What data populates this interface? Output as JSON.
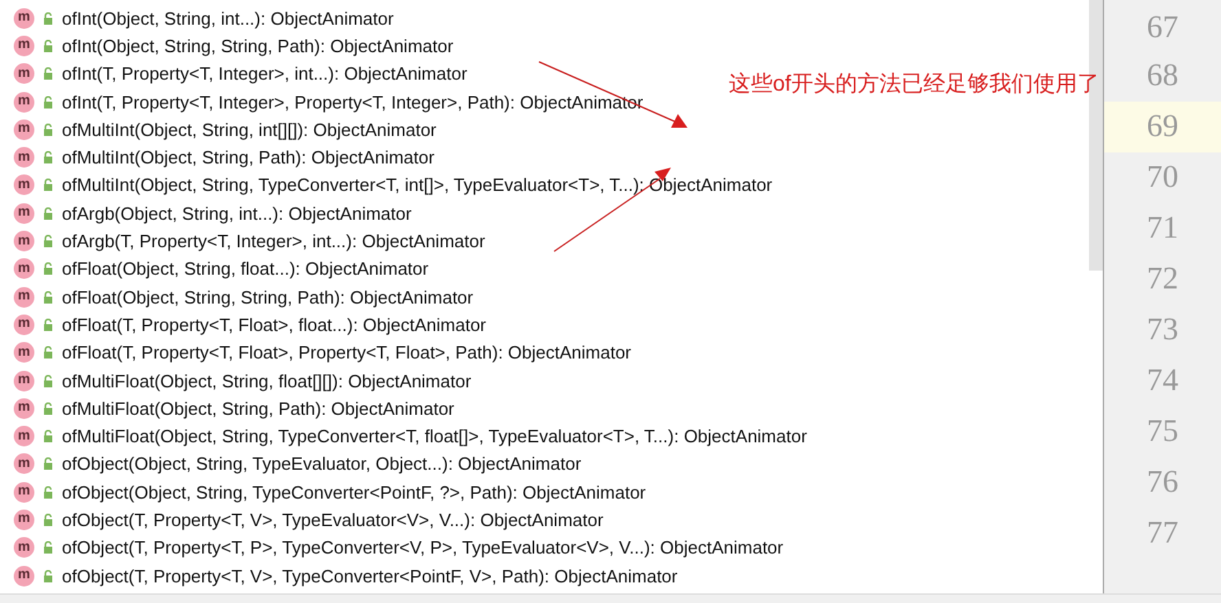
{
  "methods": [
    {
      "icon_letter": "m",
      "signature": "ofInt(Object, String, int...): ObjectAnimator"
    },
    {
      "icon_letter": "m",
      "signature": "ofInt(Object, String, String, Path): ObjectAnimator"
    },
    {
      "icon_letter": "m",
      "signature": "ofInt(T, Property<T, Integer>, int...): ObjectAnimator"
    },
    {
      "icon_letter": "m",
      "signature": "ofInt(T, Property<T, Integer>, Property<T, Integer>, Path): ObjectAnimator"
    },
    {
      "icon_letter": "m",
      "signature": "ofMultiInt(Object, String, int[][]): ObjectAnimator"
    },
    {
      "icon_letter": "m",
      "signature": "ofMultiInt(Object, String, Path): ObjectAnimator"
    },
    {
      "icon_letter": "m",
      "signature": "ofMultiInt(Object, String, TypeConverter<T, int[]>, TypeEvaluator<T>, T...): ObjectAnimator"
    },
    {
      "icon_letter": "m",
      "signature": "ofArgb(Object, String, int...): ObjectAnimator"
    },
    {
      "icon_letter": "m",
      "signature": "ofArgb(T, Property<T, Integer>, int...): ObjectAnimator"
    },
    {
      "icon_letter": "m",
      "signature": "ofFloat(Object, String, float...): ObjectAnimator"
    },
    {
      "icon_letter": "m",
      "signature": "ofFloat(Object, String, String, Path): ObjectAnimator"
    },
    {
      "icon_letter": "m",
      "signature": "ofFloat(T, Property<T, Float>, float...): ObjectAnimator"
    },
    {
      "icon_letter": "m",
      "signature": "ofFloat(T, Property<T, Float>, Property<T, Float>, Path): ObjectAnimator"
    },
    {
      "icon_letter": "m",
      "signature": "ofMultiFloat(Object, String, float[][]): ObjectAnimator"
    },
    {
      "icon_letter": "m",
      "signature": "ofMultiFloat(Object, String, Path): ObjectAnimator"
    },
    {
      "icon_letter": "m",
      "signature": "ofMultiFloat(Object, String, TypeConverter<T, float[]>, TypeEvaluator<T>, T...): ObjectAnimator"
    },
    {
      "icon_letter": "m",
      "signature": "ofObject(Object, String, TypeEvaluator, Object...): ObjectAnimator"
    },
    {
      "icon_letter": "m",
      "signature": "ofObject(Object, String, TypeConverter<PointF, ?>, Path): ObjectAnimator"
    },
    {
      "icon_letter": "m",
      "signature": "ofObject(T, Property<T, V>, TypeEvaluator<V>, V...): ObjectAnimator"
    },
    {
      "icon_letter": "m",
      "signature": "ofObject(T, Property<T, P>, TypeConverter<V, P>, TypeEvaluator<V>, V...): ObjectAnimator"
    },
    {
      "icon_letter": "m",
      "signature": "ofObject(T, Property<T, V>, TypeConverter<PointF, V>, Path): ObjectAnimator"
    }
  ],
  "annotation": "这些of开头的方法已经足够我们使用了",
  "line_numbers": [
    {
      "number": "67",
      "selected": false
    },
    {
      "number": "68",
      "selected": false
    },
    {
      "number": "69",
      "selected": true
    },
    {
      "number": "70",
      "selected": false
    },
    {
      "number": "71",
      "selected": false
    },
    {
      "number": "72",
      "selected": false
    },
    {
      "number": "73",
      "selected": false
    },
    {
      "number": "74",
      "selected": false
    },
    {
      "number": "75",
      "selected": false
    },
    {
      "number": "76",
      "selected": false
    },
    {
      "number": "77",
      "selected": false
    }
  ]
}
